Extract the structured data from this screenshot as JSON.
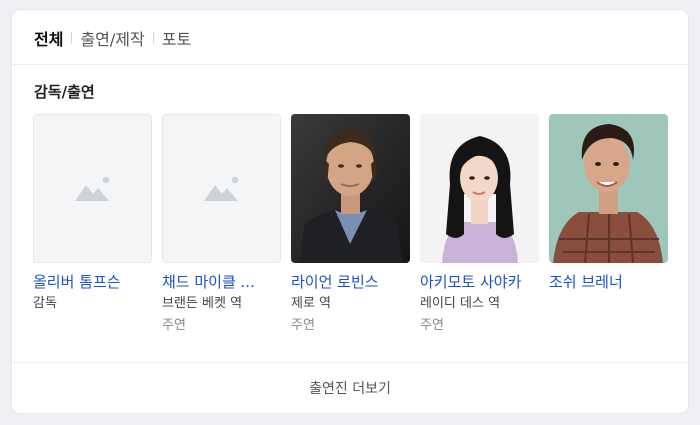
{
  "tabs": [
    {
      "label": "전체",
      "active": true
    },
    {
      "label": "출연/제작",
      "active": false
    },
    {
      "label": "포토",
      "active": false
    }
  ],
  "section_title": "감독/출연",
  "people": [
    {
      "name": "올리버 톰프슨",
      "role": "감독",
      "sub": "",
      "photo": "placeholder-image-icon"
    },
    {
      "name": "채드 마이클 ...",
      "role": "브랜든 베켓 역",
      "sub": "주연",
      "photo": "placeholder-image-icon"
    },
    {
      "name": "라이언 로빈스",
      "role": "제로 역",
      "sub": "주연",
      "photo": "portrait-photo"
    },
    {
      "name": "아키모토 사야카",
      "role": "레이디 데스 역",
      "sub": "주연",
      "photo": "portrait-photo"
    },
    {
      "name": "조쉬 브레너",
      "role": "",
      "sub": "",
      "photo": "portrait-photo"
    }
  ],
  "more_label": "출연진 더보기",
  "colors": {
    "link": "#1a52c9",
    "background": "#eef0f3",
    "card": "#ffffff"
  }
}
